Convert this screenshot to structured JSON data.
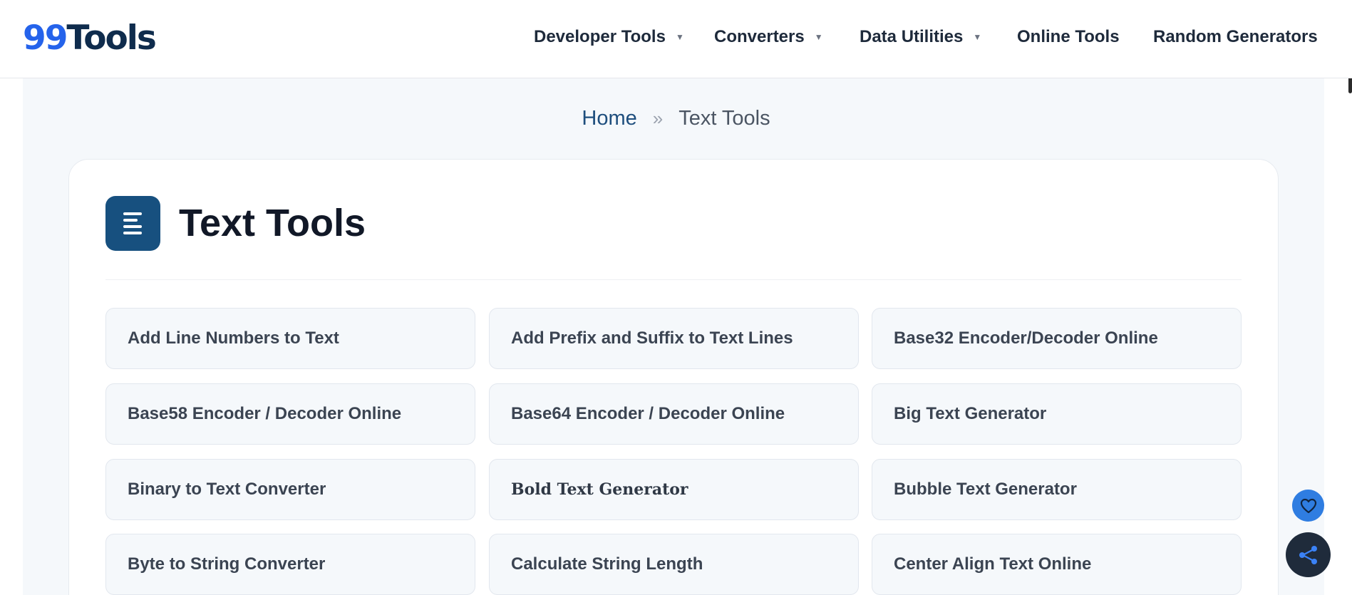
{
  "logo": {
    "num": "99",
    "word": "Tools"
  },
  "nav": [
    {
      "label": "Developer Tools",
      "dropdown": true
    },
    {
      "label": "Converters",
      "dropdown": true
    },
    {
      "label": "Data Utilities",
      "dropdown": true
    },
    {
      "label": "Online Tools",
      "dropdown": false
    },
    {
      "label": "Random Generators",
      "dropdown": false
    }
  ],
  "breadcrumb": {
    "home": "Home",
    "separator": "»",
    "current": "Text Tools"
  },
  "page": {
    "title": "Text Tools",
    "icon": "text-align-left-icon"
  },
  "tools": [
    "Add Line Numbers to Text",
    "Add Prefix and Suffix to Text Lines",
    "Base32 Encoder/Decoder Online",
    "Base58 Encoder / Decoder Online",
    "Base64 Encoder / Decoder Online",
    "Big Text Generator",
    "Binary to Text Converter",
    "Bold Text Generator",
    "Bubble Text Generator",
    "Byte to String Converter",
    "Calculate String Length",
    "Center Align Text Online"
  ],
  "floating": {
    "favorite_icon": "heart-icon",
    "share_icon": "share-icon"
  },
  "colors": {
    "brand_blue": "#2563eb",
    "brand_dark": "#0f2c4d",
    "icon_bg": "#17507f",
    "share_bg": "#1f2b3b"
  }
}
